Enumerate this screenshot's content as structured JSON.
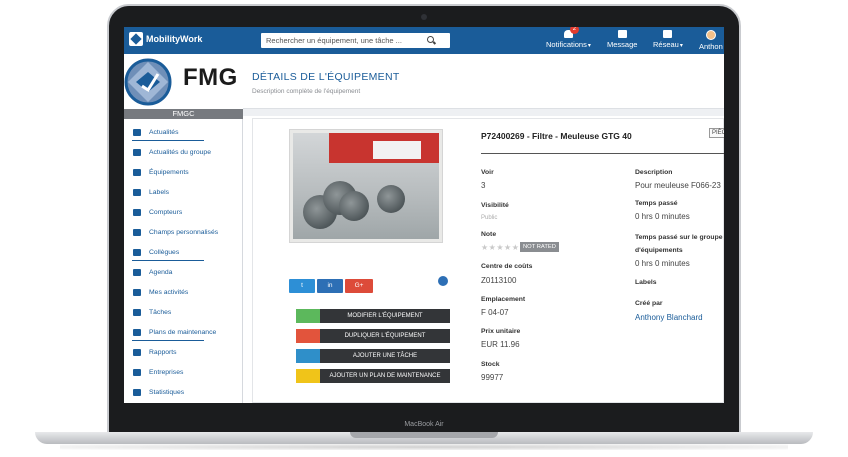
{
  "device": {
    "model": "MacBook Air"
  },
  "topbar": {
    "brand": "MobilityWork",
    "search_placeholder": "Rechercher un équipement, une tâche ...",
    "nav": [
      {
        "label": "Notifications",
        "badge": "2"
      },
      {
        "label": "Message"
      },
      {
        "label": "Réseau"
      },
      {
        "label": "Anthon"
      }
    ]
  },
  "sidebar": {
    "logo_text": "FMG",
    "group_name": "FMGC",
    "items": [
      {
        "label": "Actualités",
        "icon": "news-icon"
      },
      {
        "label": "Actualités du groupe",
        "icon": "group-news-icon"
      },
      {
        "label": "Équipements",
        "icon": "wrench-icon"
      },
      {
        "label": "Labels",
        "icon": "tag-icon"
      },
      {
        "label": "Compteurs",
        "icon": "wifi-icon"
      },
      {
        "label": "Champs personnalisés",
        "icon": "text-field-icon"
      },
      {
        "label": "Collègues",
        "icon": "users-icon"
      },
      {
        "label": "Agenda",
        "icon": "calendar-icon"
      },
      {
        "label": "Mes activités",
        "icon": "clock-icon"
      },
      {
        "label": "Tâches",
        "icon": "list-icon"
      },
      {
        "label": "Plans de maintenance",
        "icon": "calendar-check-icon"
      },
      {
        "label": "Rapports",
        "icon": "document-icon"
      },
      {
        "label": "Entreprises",
        "icon": "building-icon"
      },
      {
        "label": "Statistiques",
        "icon": "stats-icon"
      }
    ]
  },
  "page": {
    "title": "DÉTAILS DE L'ÉQUIPEMENT",
    "subtitle": "Description complète de l'équipement"
  },
  "equipment": {
    "title": "P72400269 - Filtre - Meuleuse GTG 40",
    "badge": "PIÈCE",
    "social": {
      "twitter": "t",
      "linkedin": "in",
      "google": "G+"
    },
    "actions": [
      {
        "label": "MODIFIER L'ÉQUIPEMENT",
        "color": "#5cb85c"
      },
      {
        "label": "DUPLIQUER L'ÉQUIPEMENT",
        "color": "#e2543c"
      },
      {
        "label": "AJOUTER UNE TÂCHE",
        "color": "#2f8fc9"
      },
      {
        "label": "AJOUTER UN PLAN DE MAINTENANCE",
        "color": "#f0c419"
      }
    ],
    "left_fields": {
      "voir_label": "Voir",
      "voir_value": "3",
      "visibilite_label": "Visibilité",
      "visibilite_value": "Public",
      "note_label": "Note",
      "note_status": "NOT RATED",
      "centre_label": "Centre de coûts",
      "centre_value": "Z0113100",
      "emplacement_label": "Emplacement",
      "emplacement_value": "F 04-07",
      "prix_label": "Prix unitaire",
      "prix_value": "EUR 11.96",
      "stock_label": "Stock",
      "stock_value": "99977"
    },
    "right_fields": {
      "description_label": "Description",
      "description_value": "Pour meuleuse F066-23",
      "temps_label": "Temps passé",
      "temps_value": "0 hrs 0 minutes",
      "temps_groupe_label": "Temps passé sur le groupe d'équipements",
      "temps_groupe_value": "0 hrs 0 minutes",
      "labels_label": "Labels",
      "cree_label": "Créé par",
      "cree_value": "Anthony Blanchard"
    }
  }
}
